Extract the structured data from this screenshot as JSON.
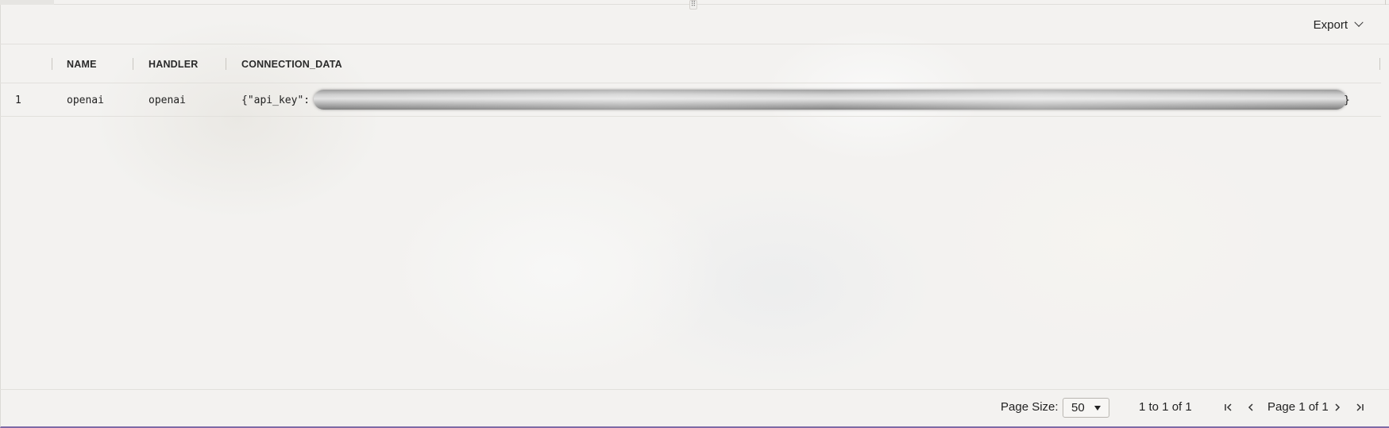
{
  "toolbar": {
    "export_label": "Export",
    "export_icon": "chevron-down-icon",
    "resize_handle_icon": "drag-handle-icon"
  },
  "grid": {
    "columns": [
      "",
      "NAME",
      "HANDLER",
      "CONNECTION_DATA"
    ],
    "rows": [
      {
        "index": "1",
        "name": "openai",
        "handler": "openai",
        "connection_data_prefix": "{\"api_key\":",
        "connection_data_suffix": "}",
        "connection_data_redacted": true
      }
    ]
  },
  "footer": {
    "page_size_label": "Page Size:",
    "page_size_value": "50",
    "range_text": "1 to 1 of 1",
    "page_text": "Page 1 of 1",
    "icons": [
      "first-page-icon",
      "previous-page-icon",
      "next-page-icon",
      "last-page-icon"
    ]
  },
  "colors": {
    "accent_bottom_border": "#7d6aa6"
  }
}
